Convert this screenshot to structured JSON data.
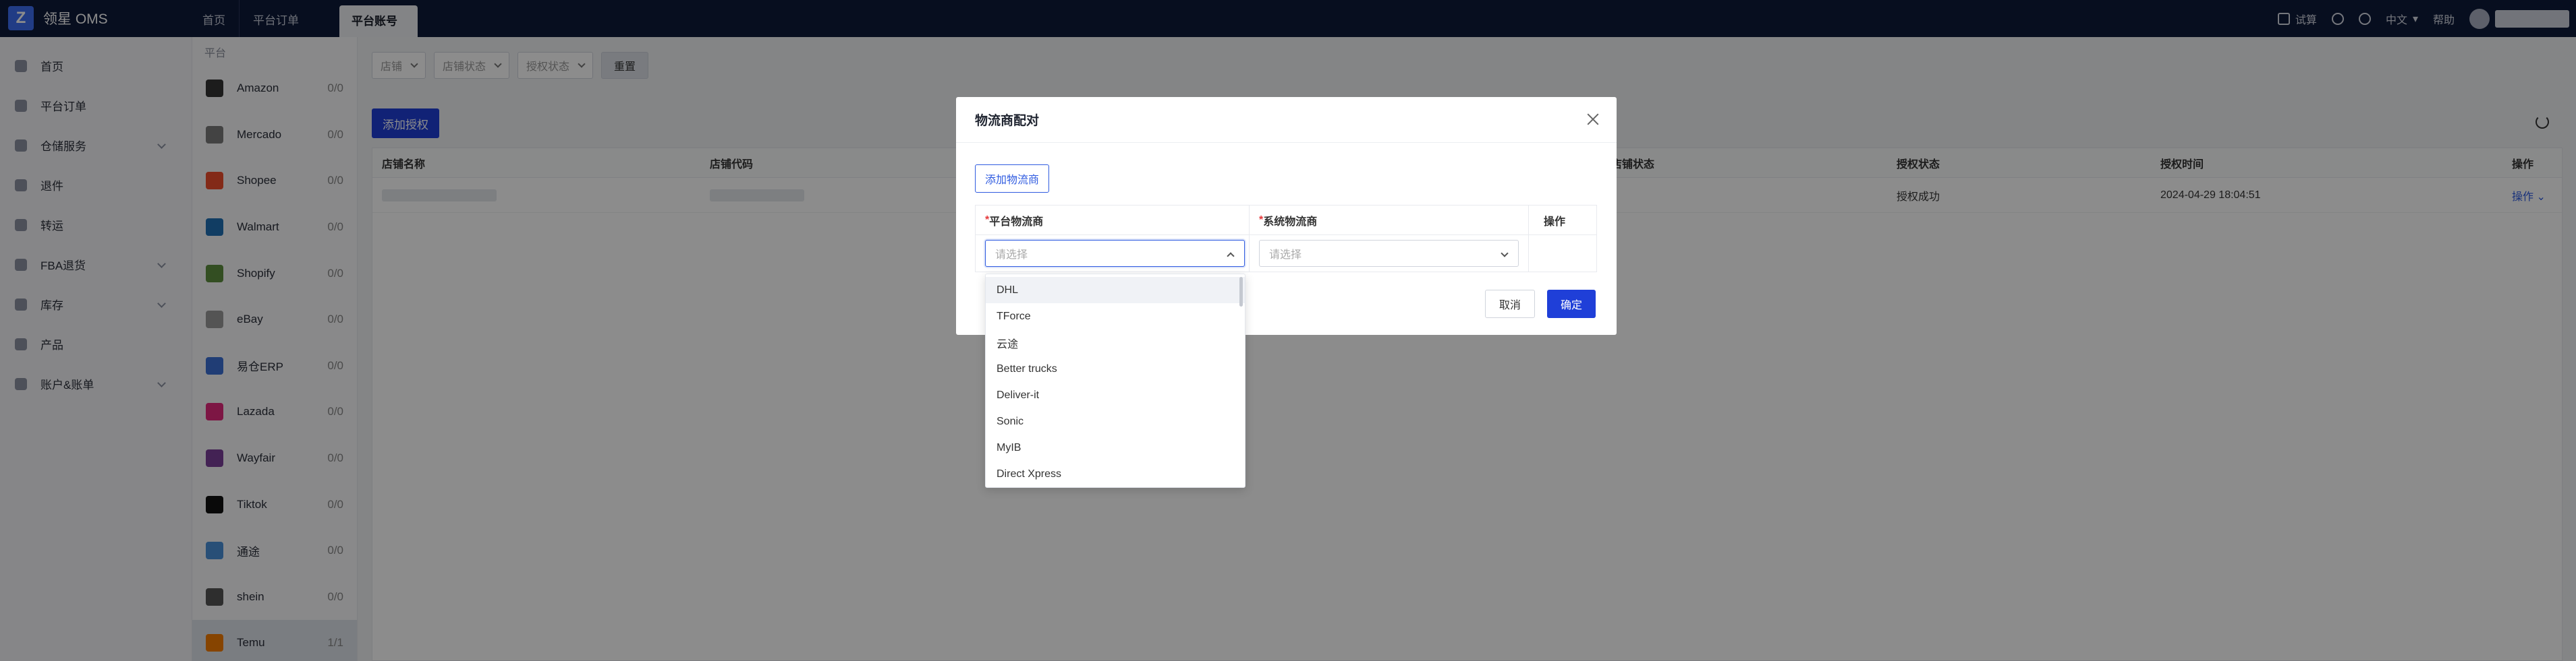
{
  "app": {
    "logo_mark": "Z",
    "title": "领星 OMS"
  },
  "topnav": {
    "tabs": [
      {
        "label": "首页"
      },
      {
        "label": "平台订单"
      },
      {
        "label": "平台账号"
      }
    ]
  },
  "topright": {
    "trial": "试算",
    "language": "中文",
    "help": "帮助"
  },
  "sidebar": {
    "items": [
      {
        "label": "首页",
        "expandable": false
      },
      {
        "label": "平台订单",
        "expandable": false
      },
      {
        "label": "仓储服务",
        "expandable": true
      },
      {
        "label": "退件",
        "expandable": false
      },
      {
        "label": "转运",
        "expandable": false
      },
      {
        "label": "FBA退货",
        "expandable": true
      },
      {
        "label": "库存",
        "expandable": true
      },
      {
        "label": "产品",
        "expandable": false
      },
      {
        "label": "账户&账单",
        "expandable": true
      }
    ]
  },
  "platforms": {
    "header": "平台",
    "items": [
      {
        "name": "Amazon",
        "count": "0/0",
        "icon": "amazon-logo",
        "color": "#333333"
      },
      {
        "name": "Mercado",
        "count": "0/0",
        "icon": "mercado-logo",
        "color": "#7a7a7a"
      },
      {
        "name": "Shopee",
        "count": "0/0",
        "icon": "shopee-logo",
        "color": "#ee4d2d"
      },
      {
        "name": "Walmart",
        "count": "0/0",
        "icon": "walmart-logo",
        "color": "#1f6fb5"
      },
      {
        "name": "Shopify",
        "count": "0/0",
        "icon": "shopify-logo",
        "color": "#5e8e3e"
      },
      {
        "name": "eBay",
        "count": "0/0",
        "icon": "ebay-logo",
        "color": "#999999"
      },
      {
        "name": "易仓ERP",
        "count": "0/0",
        "icon": "yicang-logo",
        "color": "#3b6fd6"
      },
      {
        "name": "Lazada",
        "count": "0/0",
        "icon": "lazada-logo",
        "color": "#e4287c"
      },
      {
        "name": "Wayfair",
        "count": "0/0",
        "icon": "wayfair-logo",
        "color": "#7b3f99"
      },
      {
        "name": "Tiktok",
        "count": "0/0",
        "icon": "tiktok-logo",
        "color": "#111111"
      },
      {
        "name": "通途",
        "count": "0/0",
        "icon": "tongtu-logo",
        "color": "#4a90d9"
      },
      {
        "name": "shein",
        "count": "0/0",
        "icon": "shein-logo",
        "color": "#555555"
      },
      {
        "name": "Temu",
        "count": "1/1",
        "icon": "temu-logo",
        "color": "#f57c00",
        "active": true
      }
    ]
  },
  "filters": {
    "shop": "店铺",
    "shop_status": "店铺状态",
    "auth_status": "授权状态",
    "reset": "重置"
  },
  "main": {
    "add_auth": "添加授权",
    "columns": {
      "shop_name": "店铺名称",
      "shop_code": "店铺代码",
      "shop_status": "店铺状态",
      "auth_status": "授权状态",
      "auth_time": "授权时间",
      "action": "操作"
    },
    "row": {
      "auth_status": "授权成功",
      "auth_time": "2024-04-29 18:04:51",
      "action": "操作"
    }
  },
  "modal": {
    "title": "物流商配对",
    "add_carrier": "添加物流商",
    "col_platform": "平台物流商",
    "col_system": "系统物流商",
    "col_action": "操作",
    "placeholder_platform": "请选择",
    "placeholder_system": "请选择",
    "cancel": "取消",
    "confirm": "确定"
  },
  "dropdown": {
    "options": [
      "DHL",
      "TForce",
      "云途",
      "Better trucks",
      "Deliver-it",
      "Sonic",
      "MyIB",
      "Direct Xpress"
    ]
  }
}
